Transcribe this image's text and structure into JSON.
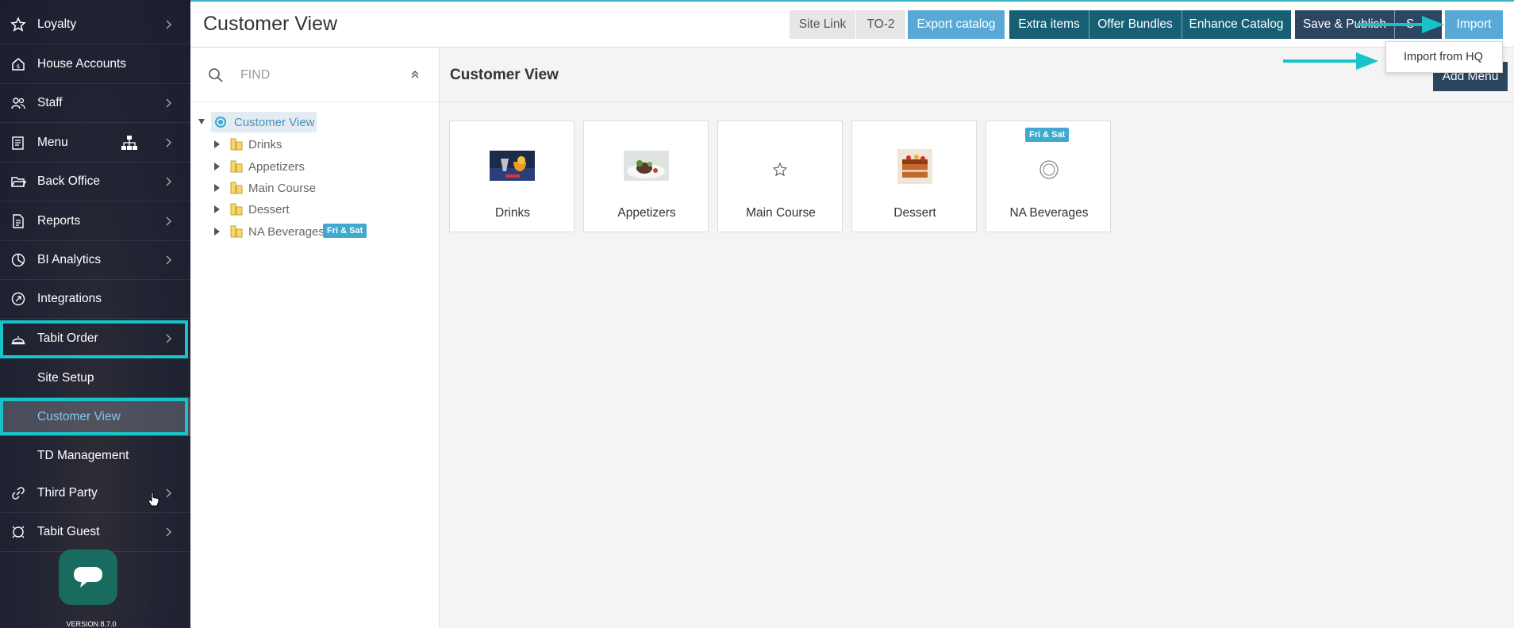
{
  "sidebar": {
    "items": [
      {
        "label": "Loyalty",
        "icon": "star-icon"
      },
      {
        "label": "House Accounts",
        "icon": "house-icon"
      },
      {
        "label": "Staff",
        "icon": "people-icon"
      },
      {
        "label": "Menu",
        "icon": "menu-book-icon"
      },
      {
        "label": "Back Office",
        "icon": "folder-open-icon"
      },
      {
        "label": "Reports",
        "icon": "document-icon"
      },
      {
        "label": "BI Analytics",
        "icon": "pie-chart-icon"
      },
      {
        "label": "Integrations",
        "icon": "integration-icon"
      },
      {
        "label": "Tabit Order",
        "icon": "cloche-icon"
      },
      {
        "label": "Third Party",
        "icon": "link-icon"
      },
      {
        "label": "Tabit Guest",
        "icon": "guest-icon"
      }
    ],
    "sub_items": [
      {
        "label": "Site Setup"
      },
      {
        "label": "Customer View"
      },
      {
        "label": "TD Management"
      }
    ],
    "version": "VERSION 8.7.0"
  },
  "header": {
    "title": "Customer View",
    "buttons": {
      "site_link": "Site Link",
      "to2": "TO-2",
      "export_catalog": "Export catalog",
      "extra_items": "Extra items",
      "offer_bundles": "Offer Bundles",
      "enhance_catalog": "Enhance Catalog",
      "save_publish": "Save & Publish",
      "hidden_btn": "S",
      "import": "Import"
    }
  },
  "dropdown": {
    "import_from_hq": "Import from HQ"
  },
  "tree": {
    "find_placeholder": "FIND",
    "root": "Customer View",
    "nodes": [
      {
        "label": "Drinks"
      },
      {
        "label": "Appetizers"
      },
      {
        "label": "Main Course"
      },
      {
        "label": "Dessert"
      },
      {
        "label": "NA Beverages",
        "badge": "Fri & Sat"
      }
    ]
  },
  "main": {
    "title": "Customer View",
    "add_menu": "Add Menu",
    "cards": [
      {
        "label": "Drinks",
        "image": "drinks-photo"
      },
      {
        "label": "Appetizers",
        "image": "appetizers-photo"
      },
      {
        "label": "Main Course",
        "image": "star-icon"
      },
      {
        "label": "Dessert",
        "image": "dessert-photo"
      },
      {
        "label": "NA Beverages",
        "image": "circle-icon",
        "badge": "Fri & Sat"
      }
    ]
  },
  "colors": {
    "accent_teal": "#17c3c9",
    "header_border": "#3ab3c7",
    "button_blue": "#58a9d6",
    "button_teal": "#175f74",
    "button_navy": "#2c4561",
    "badge_blue": "#3fa9cf"
  }
}
